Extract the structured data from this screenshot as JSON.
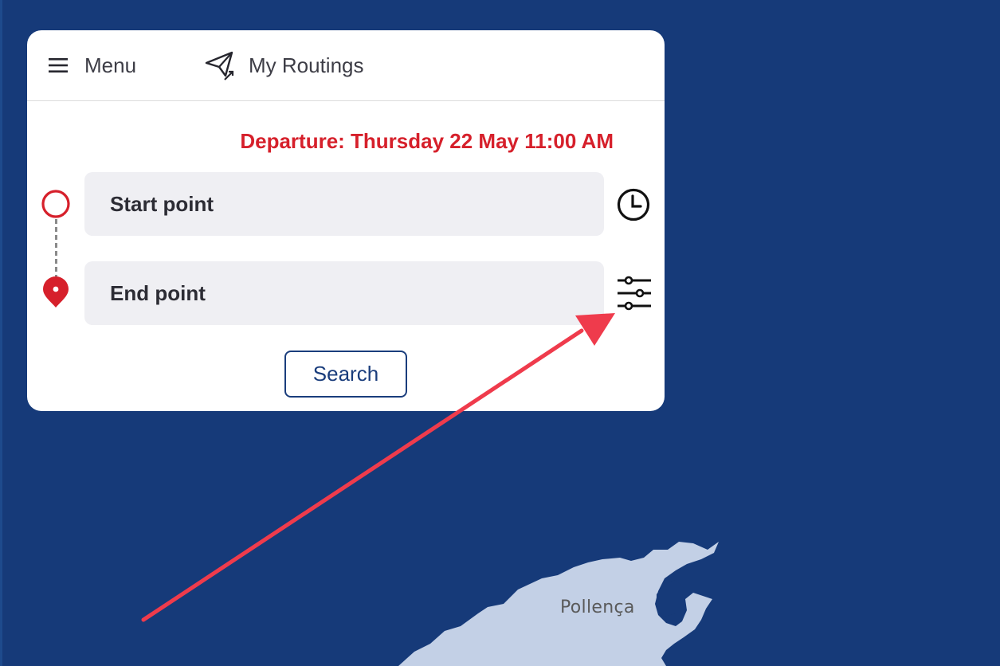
{
  "header": {
    "menu_label": "Menu",
    "menu_icon": "hamburger-icon",
    "routings_label": "My Routings",
    "routings_icon": "paper-plane-icon"
  },
  "planner": {
    "departure_text": "Departure: Thursday 22 May 11:00 AM",
    "start_placeholder": "Start point",
    "end_placeholder": "End point",
    "time_icon": "clock-icon",
    "options_icon": "sliders-icon",
    "search_label": "Search"
  },
  "map": {
    "place_label": "Pollença",
    "water_color": "#163a79",
    "land_color": "#c3d0e6"
  },
  "colors": {
    "accent_red": "#d6202b",
    "brand_blue": "#1a3d7c",
    "annotation_arrow": "#ef3b4c"
  }
}
